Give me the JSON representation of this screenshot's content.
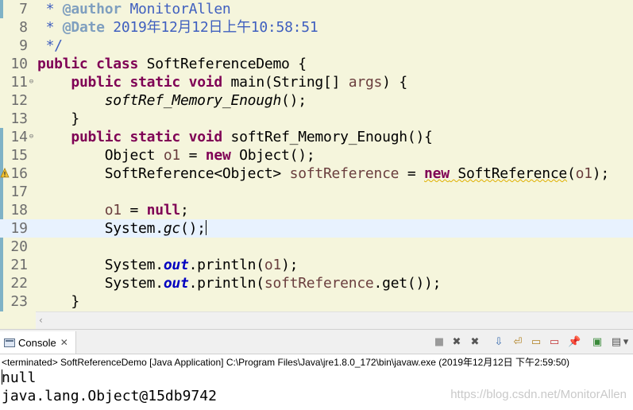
{
  "editor": {
    "lines": [
      {
        "no": "7",
        "fold": false,
        "segments": [
          [
            "doc",
            " * "
          ],
          [
            "doctag",
            "@author"
          ],
          [
            "doc",
            " MonitorAllen"
          ]
        ]
      },
      {
        "no": "8",
        "fold": false,
        "segments": [
          [
            "doc",
            " * "
          ],
          [
            "doctag",
            "@Date"
          ],
          [
            "doc",
            " 2019年12月12日上午10:58:51"
          ]
        ]
      },
      {
        "no": "9",
        "fold": false,
        "segments": [
          [
            "doc",
            " */"
          ]
        ]
      },
      {
        "no": "10",
        "fold": false,
        "segments": [
          [
            "kw",
            "public"
          ],
          [
            "plain",
            " "
          ],
          [
            "kw",
            "class"
          ],
          [
            "plain",
            " SoftReferenceDemo {"
          ]
        ]
      },
      {
        "no": "11",
        "fold": true,
        "segments": [
          [
            "plain",
            "    "
          ],
          [
            "kw",
            "public"
          ],
          [
            "plain",
            " "
          ],
          [
            "kw",
            "static"
          ],
          [
            "plain",
            " "
          ],
          [
            "kw",
            "void"
          ],
          [
            "plain",
            " main(String[] "
          ],
          [
            "var",
            "args"
          ],
          [
            "plain",
            ") {"
          ]
        ]
      },
      {
        "no": "12",
        "fold": false,
        "segments": [
          [
            "plain",
            "        "
          ],
          [
            "it",
            "softRef_Memory_Enough"
          ],
          [
            "plain",
            "();"
          ]
        ]
      },
      {
        "no": "13",
        "fold": false,
        "segments": [
          [
            "plain",
            "    }"
          ]
        ]
      },
      {
        "no": "14",
        "fold": true,
        "segments": [
          [
            "plain",
            "    "
          ],
          [
            "kw",
            "public"
          ],
          [
            "plain",
            " "
          ],
          [
            "kw",
            "static"
          ],
          [
            "plain",
            " "
          ],
          [
            "kw",
            "void"
          ],
          [
            "plain",
            " softRef_Memory_Enough(){"
          ]
        ]
      },
      {
        "no": "15",
        "fold": false,
        "segments": [
          [
            "plain",
            "        Object "
          ],
          [
            "var",
            "o1"
          ],
          [
            "plain",
            " = "
          ],
          [
            "kw",
            "new"
          ],
          [
            "plain",
            " Object();"
          ]
        ]
      },
      {
        "no": "16",
        "fold": false,
        "warning": true,
        "segments": [
          [
            "plain",
            "        SoftReference<Object> "
          ],
          [
            "var",
            "softReference"
          ],
          [
            "plain",
            " = "
          ],
          [
            "kwsq",
            "new"
          ],
          [
            "sq",
            " SoftReference"
          ],
          [
            "plain",
            "("
          ],
          [
            "var",
            "o1"
          ],
          [
            "plain",
            ");"
          ]
        ]
      },
      {
        "no": "17",
        "fold": false,
        "segments": []
      },
      {
        "no": "18",
        "fold": false,
        "segments": [
          [
            "plain",
            "        "
          ],
          [
            "var",
            "o1"
          ],
          [
            "plain",
            " = "
          ],
          [
            "kw",
            "null"
          ],
          [
            "plain",
            ";"
          ]
        ]
      },
      {
        "no": "19",
        "fold": false,
        "current": true,
        "segments": [
          [
            "plain",
            "        System."
          ],
          [
            "it",
            "gc"
          ],
          [
            "plain",
            "();"
          ],
          [
            "caret",
            ""
          ]
        ]
      },
      {
        "no": "20",
        "fold": false,
        "segments": []
      },
      {
        "no": "21",
        "fold": false,
        "segments": [
          [
            "plain",
            "        System."
          ],
          [
            "fld",
            "out"
          ],
          [
            "plain",
            ".println("
          ],
          [
            "var",
            "o1"
          ],
          [
            "plain",
            ");"
          ]
        ]
      },
      {
        "no": "22",
        "fold": false,
        "segments": [
          [
            "plain",
            "        System."
          ],
          [
            "fld",
            "out"
          ],
          [
            "plain",
            ".println("
          ],
          [
            "var",
            "softReference"
          ],
          [
            "plain",
            ".get());"
          ]
        ]
      },
      {
        "no": "23",
        "fold": false,
        "segments": [
          [
            "plain",
            "    }"
          ]
        ]
      }
    ]
  },
  "console": {
    "tab_label": "Console",
    "tab_close": "✕",
    "status": "<terminated> SoftReferenceDemo [Java Application] C:\\Program Files\\Java\\jre1.8.0_172\\bin\\javaw.exe (2019年12月12日 下午2:59:50)",
    "output": [
      "null",
      "java.lang.Object@15db9742"
    ]
  },
  "toolbar": {
    "terminate_icon": "■",
    "remove_launch_icon": "✖",
    "remove_all_icon": "✖",
    "scroll_lock_icon": "⇩",
    "word_wrap_icon": "⏎",
    "show_stdout_icon": "▭",
    "show_stderr_icon": "▭",
    "pin_icon": "📌",
    "open_console_icon": "▣",
    "display_console_icon": "▤",
    "dropdown_icon": "▾",
    "minimize_icon": "−"
  },
  "watermark": "https://blog.csdn.net/MonitorAllen",
  "colors": {
    "editor_bg": "#f5f5dc",
    "keyword": "#7f0055",
    "javadoc": "#3f5fbf",
    "variable": "#6a3e3e",
    "field": "#0000c0"
  }
}
